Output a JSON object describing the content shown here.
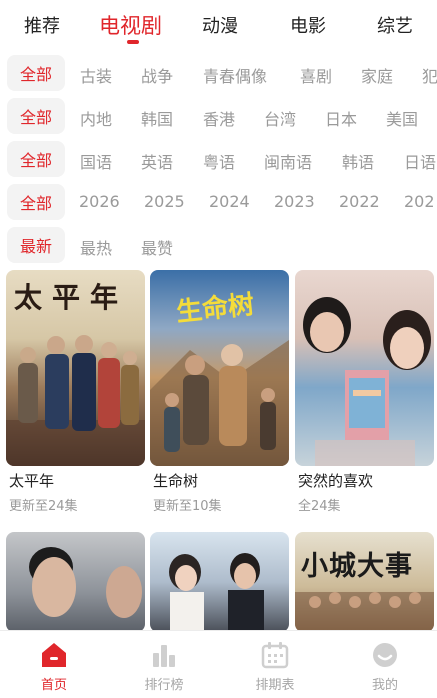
{
  "top_tabs": [
    {
      "label": "推荐"
    },
    {
      "label": "电视剧"
    },
    {
      "label": "动漫"
    },
    {
      "label": "电影"
    },
    {
      "label": "综艺"
    }
  ],
  "filters": [
    {
      "active": "全部",
      "options": [
        "古装",
        "战争",
        "青春偶像",
        "喜剧",
        "家庭",
        "犯"
      ]
    },
    {
      "active": "全部",
      "options": [
        "内地",
        "韩国",
        "香港",
        "台湾",
        "日本",
        "美国"
      ]
    },
    {
      "active": "全部",
      "options": [
        "国语",
        "英语",
        "粤语",
        "闽南语",
        "韩语",
        "日语"
      ]
    },
    {
      "active": "全部",
      "options": [
        "2026",
        "2025",
        "2024",
        "2023",
        "2022",
        "202"
      ]
    },
    {
      "active": "最新",
      "options": [
        "最热",
        "最赞"
      ]
    }
  ],
  "cards": [
    {
      "title": "太平年",
      "subtitle": "更新至24集",
      "poster_text": "太平年"
    },
    {
      "title": "生命树",
      "subtitle": "更新至10集",
      "poster_text": "生命树"
    },
    {
      "title": "突然的喜欢",
      "subtitle": "全24集",
      "poster_text": ""
    },
    {
      "title": "",
      "subtitle": "",
      "poster_text": ""
    },
    {
      "title": "",
      "subtitle": "",
      "poster_text": ""
    },
    {
      "title": "",
      "subtitle": "",
      "poster_text": "小城大事"
    }
  ],
  "bottom_nav": [
    {
      "label": "首页",
      "icon": "home-icon"
    },
    {
      "label": "排行榜",
      "icon": "bar-chart-icon"
    },
    {
      "label": "排期表",
      "icon": "calendar-icon"
    },
    {
      "label": "我的",
      "icon": "profile-icon"
    }
  ],
  "colors": {
    "accent": "#e0262b",
    "muted": "#9a9a9a",
    "chip_bg": "#f3f3f3"
  }
}
